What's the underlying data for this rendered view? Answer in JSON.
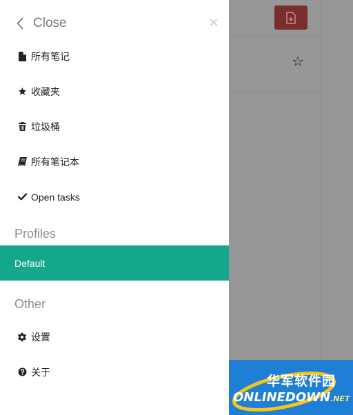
{
  "drawer": {
    "back_label": "Close",
    "nav_items": [
      {
        "label": "所有笔记",
        "icon": "document-icon"
      },
      {
        "label": "收藏夹",
        "icon": "star-icon"
      },
      {
        "label": "垃圾桶",
        "icon": "trash-icon"
      },
      {
        "label": "所有笔记本",
        "icon": "notebook-icon"
      },
      {
        "label": "Open tasks",
        "icon": "check-icon"
      }
    ],
    "profiles_title": "Profiles",
    "profiles": [
      {
        "label": "Default",
        "selected": true
      }
    ],
    "other_title": "Other",
    "other_items": [
      {
        "label": "设置",
        "icon": "gear-icon"
      },
      {
        "label": "关于",
        "icon": "help-icon"
      }
    ]
  },
  "colors": {
    "accent": "#15a78c",
    "overlay": "#979797",
    "new_note_button": "#7a2e2c"
  },
  "watermark": {
    "cn": "华军软件园",
    "en": "ONLINEDOWN",
    "suffix": ".NET"
  }
}
